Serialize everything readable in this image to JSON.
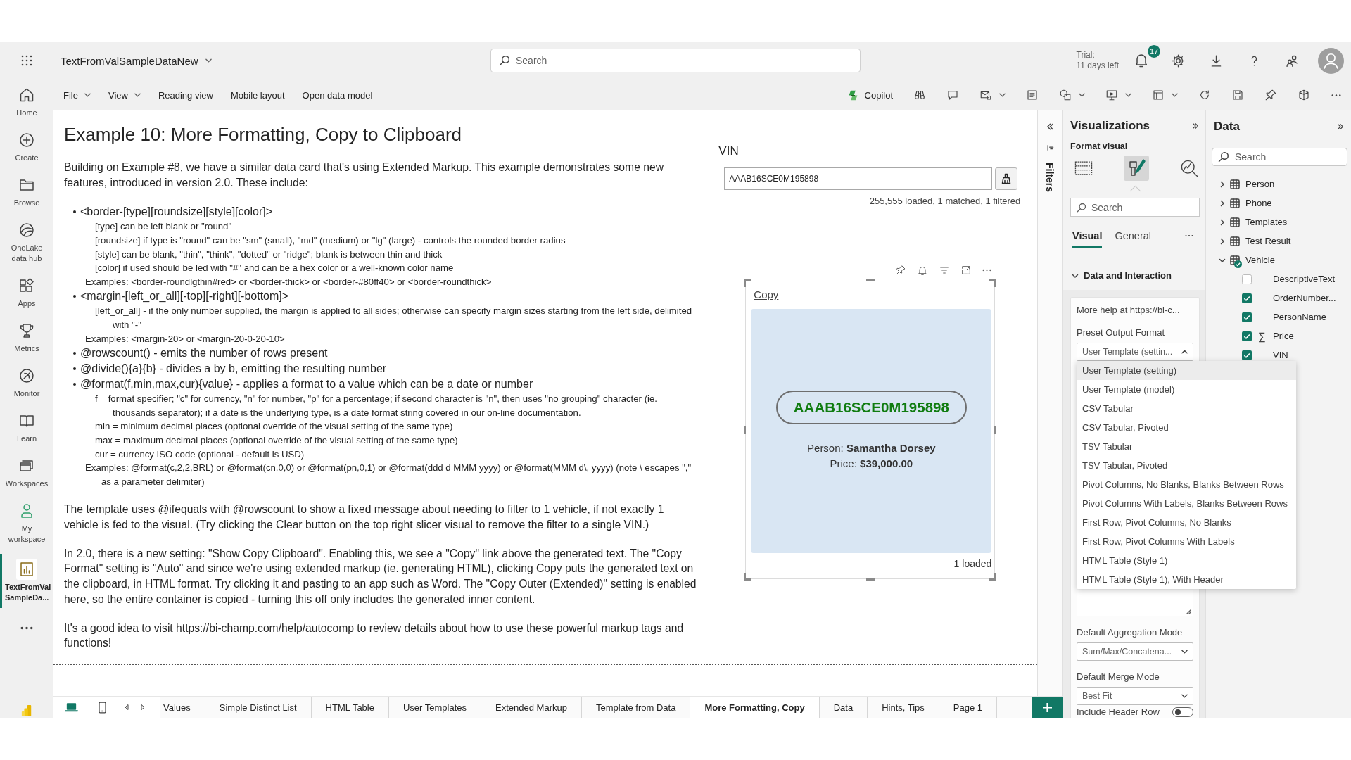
{
  "header": {
    "report_title": "TextFromValSampleDataNew",
    "search": {
      "placeholder": "Search"
    },
    "trial": {
      "label": "Trial:",
      "remaining": "11 days left"
    },
    "notifications": {
      "count": "17"
    }
  },
  "nav": [
    {
      "label": "Home",
      "selected": false
    },
    {
      "label": "Create",
      "selected": false
    },
    {
      "label": "Browse",
      "selected": false
    },
    {
      "label": "OneLake data hub",
      "selected": false
    },
    {
      "label": "Apps",
      "selected": false
    },
    {
      "label": "Metrics",
      "selected": false
    },
    {
      "label": "Monitor",
      "selected": false
    },
    {
      "label": "Learn",
      "selected": false
    },
    {
      "label": "Workspaces",
      "selected": false
    },
    {
      "label": "My workspace",
      "selected": false
    },
    {
      "label": "TextFromVal SampleDa...",
      "selected": true
    }
  ],
  "toolbar": {
    "menus": [
      {
        "label": "File",
        "has_menu": true
      },
      {
        "label": "View",
        "has_menu": true
      },
      {
        "label": "Reading view",
        "has_menu": false
      },
      {
        "label": "Mobile layout",
        "has_menu": false
      },
      {
        "label": "Open data model",
        "has_menu": false
      }
    ],
    "copilot": "Copilot"
  },
  "document": {
    "title": "Example 10: More Formatting, Copy to Clipboard",
    "intro": "Building on Example #8, we have a similar data card that's using Extended Markup. This example demonstrates some new features, introduced in version 2.0. These include:",
    "features": [
      {
        "text": "<border-[type][roundsize][style][color]>",
        "details": [
          {
            "kind": "detail",
            "text": "[type] can be left blank or \"round\""
          },
          {
            "kind": "detail",
            "text": "[roundsize] if type is \"round\" can be \"sm\" (small), \"md\" (medium) or \"lg\" (large) - controls the rounded border radius"
          },
          {
            "kind": "detail",
            "text": "[style] can be blank, \"thin\", \"think\", \"dotted\" or \"ridge\"; blank is between thin and thick"
          },
          {
            "kind": "detail",
            "text": "[color] if used should be led with \"#\" and can be a hex color or a well-known color name"
          },
          {
            "kind": "example",
            "text": "Examples: <border-roundlgthin#red> or <border-thick> or <border-#80ff40> or <border-roundthick>"
          }
        ]
      },
      {
        "text": "<margin-[left_or_all][-top][-right][-bottom]>",
        "details": [
          {
            "kind": "detail",
            "text": "[left_or_all] - if the only number supplied, the margin is applied to all sides; otherwise can specify margin sizes starting from the left side, delimited with \"-\""
          },
          {
            "kind": "example",
            "text": "Examples: <margin-20> or <margin-20-0-20-10>"
          }
        ]
      },
      {
        "text": "@rowscount() - emits the number of rows present"
      },
      {
        "text": "@divide(){a}{b} - divides a by b, emitting the resulting number"
      },
      {
        "text": "@format(f,min,max,cur){value} - applies a format to a value which can be a date or number",
        "details": [
          {
            "kind": "detail",
            "text": "f = format specifier; \"c\" for currency, \"n\" for number, \"p\" for a percentage; if second character is \"n\", then uses \"no grouping\" character (ie. thousands separator); if a date is the underlying type, is a date format string covered in our on-line documentation."
          },
          {
            "kind": "detail",
            "text": "min = minimum decimal places (optional override of the visual setting of the same type)"
          },
          {
            "kind": "detail",
            "text": "max = maximum decimal places (optional override of the visual setting of the same type)"
          },
          {
            "kind": "detail",
            "text": "cur = currency ISO code (optional - default is USD)"
          },
          {
            "kind": "example",
            "text": "Examples: @format(c,2,2,BRL) or @format(cn,0,0) or @format(pn,0,1) or @format(ddd d MMM yyyy) or @format(MMM d\\, yyyy) (note \\ escapes \",\" as a parameter delimiter)"
          }
        ]
      }
    ],
    "paragraphs": [
      "The template uses @ifequals with @rowscount to show a fixed message about needing to filter to 1 vehicle, if not exactly 1 vehicle is fed to the visual. (Try clicking the Clear button on the top right slicer visual to remove the filter to a single VIN.)",
      "In 2.0, there is a new setting: \"Show Copy Clipboard\". Enabling this, we see a \"Copy\" link above the generated text. The \"Copy Format\" setting is \"Auto\" and since we're using extended markup (ie. generating HTML), clicking Copy puts the generated text on the clipboard, in HTML format. Try clicking it and pasting to an app such as Word. The \"Copy Outer (Extended)\" setting is enabled here, so the entire container is copied - turning this off only includes the generated inner content.",
      "It's a good idea to visit https://bi-champ.com/help/autocomp to review details about how to use these powerful markup tags and functions!"
    ]
  },
  "vin_slicer": {
    "title": "VIN",
    "value": "AAAB16SCE0M195898",
    "status": "255,555 loaded, 1 matched, 1 filtered"
  },
  "card": {
    "copy_link": "Copy",
    "vin": "AAAB16SCE0M195898",
    "lines": [
      "Person: **Samantha Dorsey**",
      "Price: **$39,000.00**"
    ],
    "status": "1 loaded"
  },
  "page_tabs": [
    {
      "label": "Values",
      "selected": false
    },
    {
      "label": "Simple Distinct List",
      "selected": false
    },
    {
      "label": "HTML Table",
      "selected": false
    },
    {
      "label": "User Templates",
      "selected": false
    },
    {
      "label": "Extended Markup",
      "selected": false
    },
    {
      "label": "Template from Data",
      "selected": false
    },
    {
      "label": "More Formatting, Copy",
      "selected": true
    },
    {
      "label": "Data",
      "selected": false
    },
    {
      "label": "Hints, Tips",
      "selected": false
    },
    {
      "label": "Page 1",
      "selected": false
    }
  ],
  "filters_pane": {
    "label": "Filters"
  },
  "visualizations": {
    "title": "Visualizations",
    "subtitle": "Format visual",
    "views": [
      {
        "selected": false
      },
      {
        "selected": true
      },
      {
        "selected": false
      }
    ],
    "search": {
      "placeholder": "Search"
    },
    "tabs": [
      {
        "label": "Visual",
        "selected": true
      },
      {
        "label": "General",
        "selected": false
      }
    ],
    "section": {
      "title": "Data and Interaction",
      "expanded": true
    },
    "help": "More help at https://bi-c...",
    "settings": [
      {
        "kind": "dropdown",
        "label": "Preset Output Format",
        "value": "User Template (settin...",
        "expanded": true,
        "options": [
          {
            "label": "User Template (setting)",
            "selected": true
          },
          {
            "label": "User Template (model)",
            "selected": false
          },
          {
            "label": "CSV Tabular",
            "selected": false
          },
          {
            "label": "CSV Tabular, Pivoted",
            "selected": false
          },
          {
            "label": "TSV Tabular",
            "selected": false
          },
          {
            "label": "TSV Tabular, Pivoted",
            "selected": false
          },
          {
            "label": "Pivot Columns, No Blanks, Blanks Between Rows",
            "selected": false
          },
          {
            "label": "Pivot Columns With Labels, Blanks Between Rows",
            "selected": false
          },
          {
            "label": "First Row, Pivot Columns, No Blanks",
            "selected": false
          },
          {
            "label": "First Row, Pivot Columns With Labels",
            "selected": false
          },
          {
            "label": "HTML Table (Style 1)",
            "selected": false
          },
          {
            "label": "HTML Table (Style 1), With Header",
            "selected": false
          }
        ]
      },
      {
        "kind": "textarea"
      },
      {
        "kind": "dropdown",
        "label": "Default Aggregation Mode",
        "value": "Sum/Max/Concatena...",
        "expanded": false
      },
      {
        "kind": "dropdown",
        "label": "Default Merge Mode",
        "value": "Best Fit",
        "expanded": false
      },
      {
        "kind": "toggle",
        "label": "Include Header Row",
        "on": false
      }
    ]
  },
  "data_pane": {
    "title": "Data",
    "search": {
      "placeholder": "Search"
    },
    "tables": [
      {
        "name": "Person",
        "expanded": false,
        "in_use": false
      },
      {
        "name": "Phone",
        "expanded": false,
        "in_use": false
      },
      {
        "name": "Templates",
        "expanded": false,
        "in_use": false
      },
      {
        "name": "Test Result",
        "expanded": false,
        "in_use": false
      },
      {
        "name": "Vehicle",
        "expanded": true,
        "in_use": true,
        "children": [
          {
            "name": "DescriptiveText",
            "checked": false
          },
          {
            "name": "OrderNumber...",
            "checked": true
          },
          {
            "name": "PersonName",
            "checked": true
          },
          {
            "name": "Price",
            "checked": true,
            "symbol": "∑"
          },
          {
            "name": "VIN",
            "checked": true
          }
        ]
      }
    ]
  }
}
